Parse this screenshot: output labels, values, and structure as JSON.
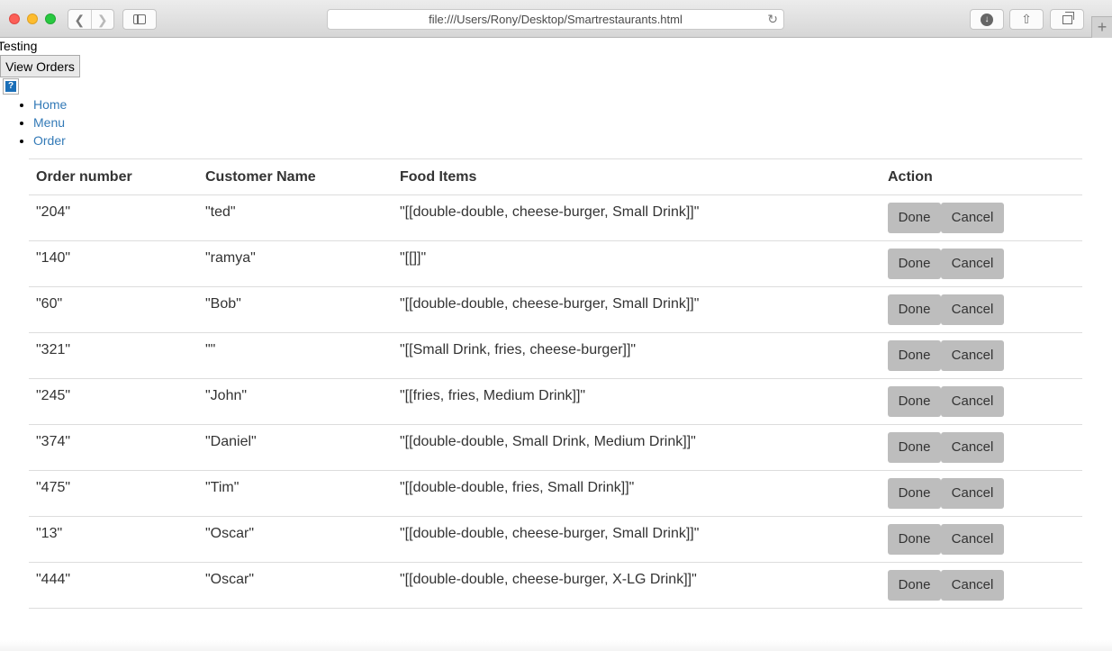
{
  "browser": {
    "url": "file:///Users/Rony/Desktop/Smartrestaurants.html",
    "icons": {
      "back": "chevron-left-icon",
      "forward": "chevron-right-icon",
      "sidebar": "sidebar-icon",
      "reload": "reload-icon",
      "download": "download-icon",
      "share": "share-icon",
      "tabs": "tabs-overview-icon",
      "new_tab": "plus-icon"
    }
  },
  "page": {
    "heading_text": "Testing",
    "view_orders_label": "View Orders",
    "help_icon_glyph": "?",
    "nav": [
      "Home",
      "Menu",
      "Order"
    ]
  },
  "table": {
    "headers": [
      "Order number",
      "Customer Name",
      "Food Items",
      "Action"
    ],
    "done_label": "Done",
    "cancel_label": "Cancel",
    "rows": [
      {
        "order": "\"204\"",
        "customer": "\"ted\"",
        "items": "\"[[double-double, cheese-burger, Small Drink]]\""
      },
      {
        "order": "\"140\"",
        "customer": "\"ramya\"",
        "items": "\"[[]]\""
      },
      {
        "order": "\"60\"",
        "customer": "\"Bob\"",
        "items": "\"[[double-double, cheese-burger, Small Drink]]\""
      },
      {
        "order": "\"321\"",
        "customer": "\"\"",
        "items": "\"[[Small Drink, fries, cheese-burger]]\""
      },
      {
        "order": "\"245\"",
        "customer": "\"John\"",
        "items": "\"[[fries, fries, Medium Drink]]\""
      },
      {
        "order": "\"374\"",
        "customer": "\"Daniel\"",
        "items": "\"[[double-double, Small Drink, Medium Drink]]\""
      },
      {
        "order": "\"475\"",
        "customer": "\"Tim\"",
        "items": "\"[[double-double, fries, Small Drink]]\""
      },
      {
        "order": "\"13\"",
        "customer": "\"Oscar\"",
        "items": "\"[[double-double, cheese-burger, Small Drink]]\""
      },
      {
        "order": "\"444\"",
        "customer": "\"Oscar\"",
        "items": "\"[[double-double, cheese-burger, X-LG Drink]]\""
      }
    ]
  },
  "colors": {
    "link": "#337ab7",
    "button_bg": "#bdbdbd",
    "row_border": "#dddddd"
  }
}
